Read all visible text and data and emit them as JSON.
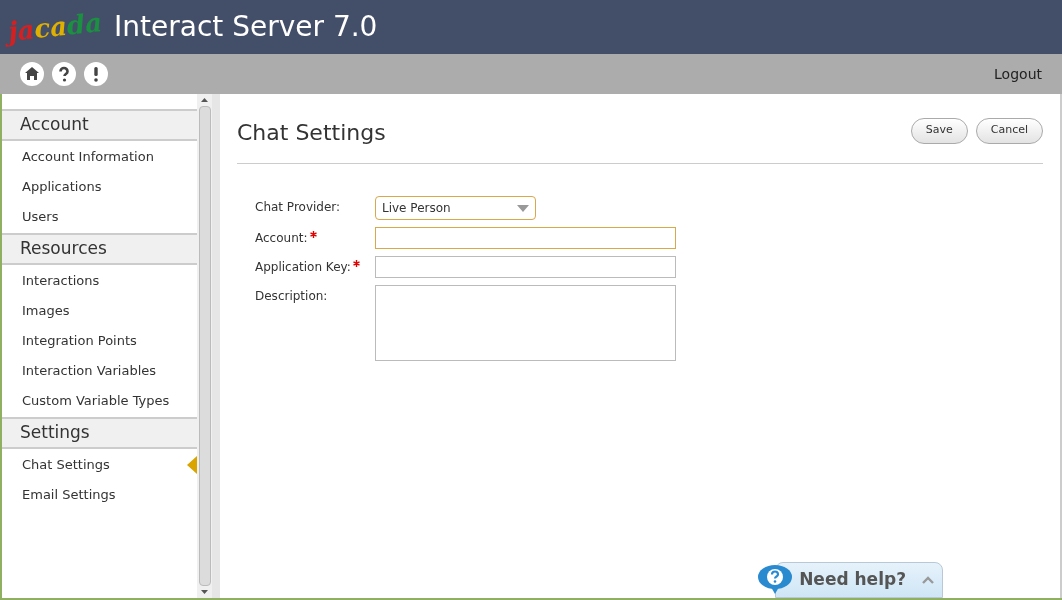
{
  "header": {
    "logo": "jacada",
    "title": "Interact Server 7.0"
  },
  "toolbar": {
    "logout": "Logout"
  },
  "sidebar": {
    "sections": [
      {
        "title": "Account",
        "items": [
          {
            "label": "Account Information",
            "selected": false
          },
          {
            "label": "Applications",
            "selected": false
          },
          {
            "label": "Users",
            "selected": false
          }
        ]
      },
      {
        "title": "Resources",
        "items": [
          {
            "label": "Interactions",
            "selected": false
          },
          {
            "label": "Images",
            "selected": false
          },
          {
            "label": "Integration Points",
            "selected": false
          },
          {
            "label": "Interaction Variables",
            "selected": false
          },
          {
            "label": "Custom Variable Types",
            "selected": false
          }
        ]
      },
      {
        "title": "Settings",
        "items": [
          {
            "label": "Chat Settings",
            "selected": true
          },
          {
            "label": "Email Settings",
            "selected": false
          }
        ]
      }
    ]
  },
  "page": {
    "title": "Chat Settings",
    "buttons": [
      "Save",
      "Cancel"
    ],
    "fields": [
      {
        "kind": "select",
        "label": "Chat Provider:",
        "required": false,
        "highlighted": true,
        "value": "Live Person"
      },
      {
        "kind": "text",
        "label": "Account:",
        "required": true,
        "highlighted": true
      },
      {
        "kind": "text",
        "label": "Application Key:",
        "required": true,
        "highlighted": false
      },
      {
        "kind": "textarea",
        "label": "Description:",
        "required": false,
        "highlighted": false
      }
    ]
  },
  "help": {
    "label": "Need help?"
  }
}
